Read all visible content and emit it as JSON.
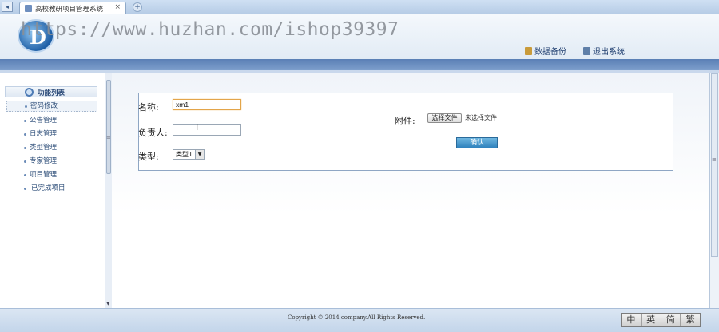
{
  "browser": {
    "tab_title": "高校教研项目管理系统",
    "tab_close": "×",
    "new_tab": "+",
    "back": "◂"
  },
  "header": {
    "watermark": "https://www.huzhan.com/ishop39397",
    "backup_label": "数据备份",
    "exit_label": "退出系统"
  },
  "sidebar": {
    "title": "功能列表",
    "items": [
      {
        "label": "密码修改"
      },
      {
        "label": "公告管理"
      },
      {
        "label": "日志管理"
      },
      {
        "label": "类型管理"
      },
      {
        "label": "专家管理"
      },
      {
        "label": "项目管理"
      },
      {
        "label": "已完成项目"
      }
    ]
  },
  "form": {
    "name_label": "名称:",
    "name_value": "xm1",
    "owner_label": "负责人:",
    "owner_value": "",
    "type_label": "类型:",
    "type_value": "类型1",
    "attach_label": "附件:",
    "file_button": "选择文件",
    "file_status": "未选择文件",
    "ok_button": "确认"
  },
  "footer": {
    "copyright": "Copyright © 2014 company.All Rights Reserved.",
    "lang_buttons": [
      "中",
      "英",
      "简",
      "繁"
    ]
  }
}
